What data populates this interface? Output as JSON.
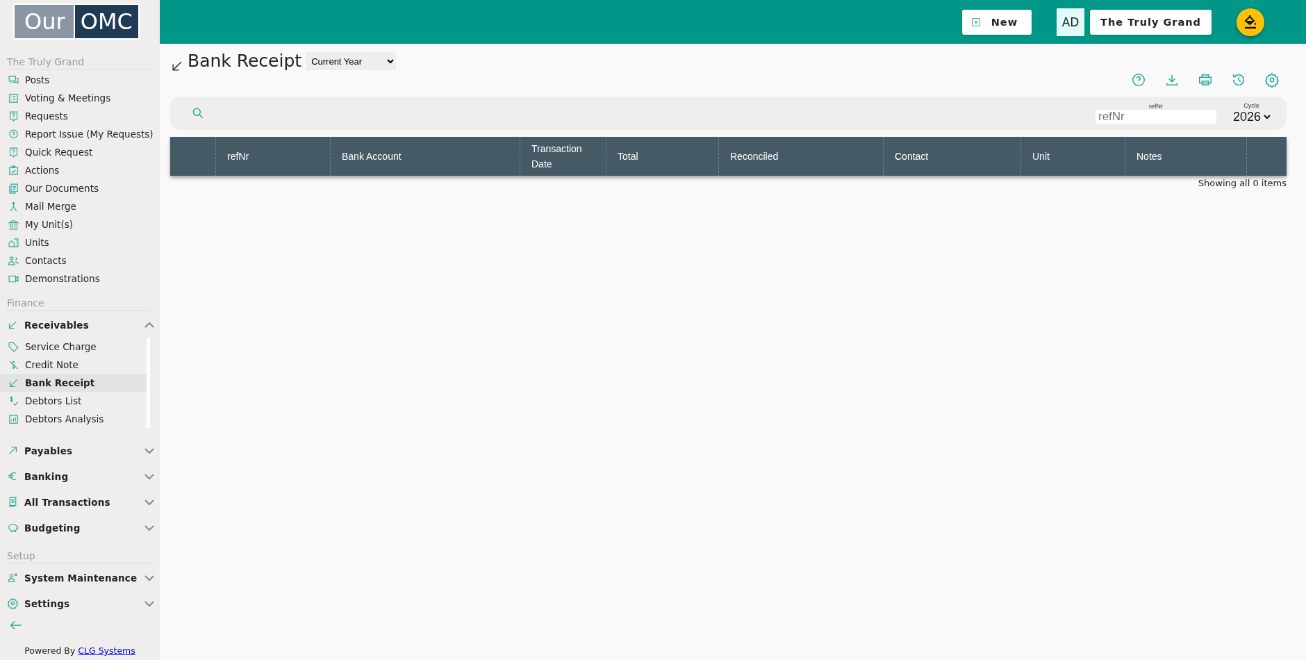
{
  "logo": {
    "left": "Our",
    "right": "OMC"
  },
  "sidebar": {
    "sections": [
      {
        "title": "The Truly Grand",
        "items": [
          {
            "kind": "link",
            "label": "Posts",
            "selected": false
          },
          {
            "kind": "link",
            "label": "Voting & Meetings",
            "selected": false
          },
          {
            "kind": "link",
            "label": "Requests",
            "selected": false
          },
          {
            "kind": "link",
            "label": "Report Issue (My Requests)",
            "selected": false
          },
          {
            "kind": "link",
            "label": "Quick Request",
            "selected": false
          },
          {
            "kind": "link",
            "label": "Actions",
            "selected": false
          },
          {
            "kind": "link",
            "label": "Our Documents",
            "selected": false
          },
          {
            "kind": "link",
            "label": "Mail Merge",
            "selected": false
          },
          {
            "kind": "link",
            "label": "My Unit(s)",
            "selected": false
          },
          {
            "kind": "link",
            "label": "Units",
            "selected": false
          },
          {
            "kind": "link",
            "label": "Contacts",
            "selected": false
          },
          {
            "kind": "link",
            "label": "Demonstrations",
            "selected": false
          }
        ]
      },
      {
        "title": "Finance",
        "items": [
          {
            "kind": "group",
            "label": "Receivables",
            "expanded": true,
            "children": [
              {
                "label": "Service Charge",
                "selected": false
              },
              {
                "label": "Credit Note",
                "selected": false
              },
              {
                "label": "Bank Receipt",
                "selected": true
              },
              {
                "label": "Debtors List",
                "selected": false
              },
              {
                "label": "Debtors Analysis",
                "selected": false
              }
            ]
          },
          {
            "kind": "group",
            "label": "Payables",
            "expanded": false
          },
          {
            "kind": "group",
            "label": "Banking",
            "expanded": false
          },
          {
            "kind": "group",
            "label": "All Transactions",
            "expanded": false
          },
          {
            "kind": "group",
            "label": "Budgeting",
            "expanded": false
          }
        ]
      },
      {
        "title": "Setup",
        "items": [
          {
            "kind": "group",
            "label": "System Maintenance",
            "expanded": false
          },
          {
            "kind": "group",
            "label": "Settings",
            "expanded": false
          }
        ]
      }
    ],
    "footer": {
      "text": "Powered By",
      "link": "CLG Systems"
    }
  },
  "topbar": {
    "new_button": "New",
    "avatar": "AD",
    "property_button": "The Truly Grand"
  },
  "page": {
    "title": "Bank Receipt",
    "period": "Current Year"
  },
  "filters": {
    "ref_label": "refNr",
    "ref_placeholder": "refNr",
    "cycle_label": "Cycle",
    "cycle_value": "2026"
  },
  "table": {
    "columns": [
      "refNr",
      "Bank Account",
      "Transaction Date",
      "Total",
      "Reconciled",
      "Contact",
      "Unit",
      "Notes"
    ],
    "status": "Showing all 0 items"
  }
}
